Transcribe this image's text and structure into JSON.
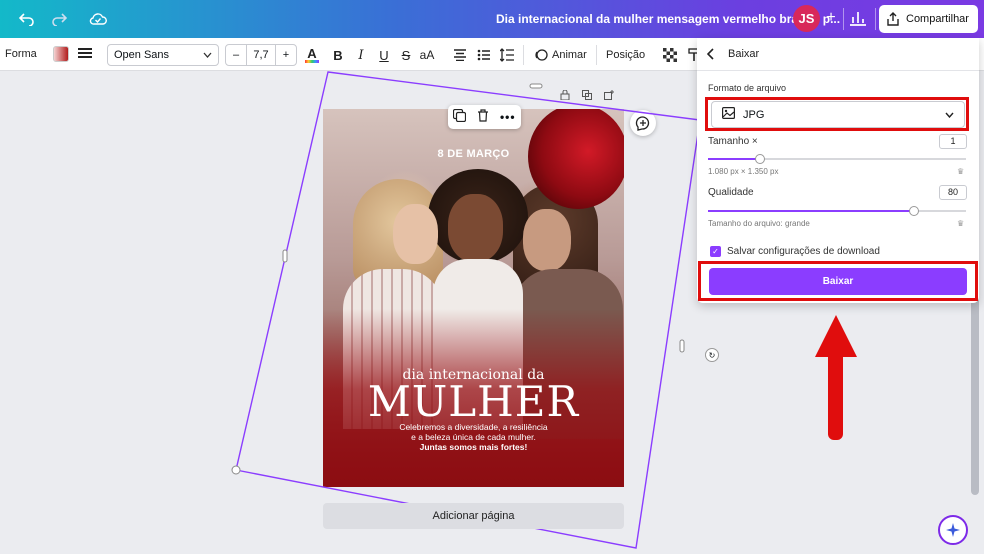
{
  "topbar": {
    "title": "Dia internacional da mulher mensagem vermelho branco p...",
    "avatar_initials": "JS",
    "plus": "+",
    "share_label": "Compartilhar",
    "gradient": [
      "#13b9c9",
      "#3a6fd6",
      "#6b3fe0",
      "#7a3ae3"
    ]
  },
  "toolbar": {
    "shape_label": "Forma",
    "font_name": "Open Sans",
    "font_size": "7,7",
    "minus": "–",
    "plus": "+",
    "bold": "B",
    "italic": "I",
    "underline": "U",
    "strike": "S",
    "case": "aA",
    "animate_label": "Animar",
    "position_label": "Posição",
    "text_color_glyph": "A"
  },
  "design": {
    "date_prefix": "8 DE",
    "date_month": "MARÇO",
    "line1": "dia internacional da",
    "line2": "MULHER",
    "body_line1": "Celebremos a diversidade, a resiliência",
    "body_line2": "e a beleza única de cada mulher.",
    "body_line3": "Juntas somos mais fortes!"
  },
  "canvas": {
    "add_page_label": "Adicionar página"
  },
  "download_panel": {
    "title": "Baixar",
    "file_format_label": "Formato de arquivo",
    "file_format_value": "JPG",
    "size_label": "Tamanho ×",
    "size_value": "1",
    "size_fill": 0.2,
    "dimensions": "1.080 px × 1.350 px",
    "quality_label": "Qualidade",
    "quality_value": "80",
    "quality_fill": 0.8,
    "file_size": "Tamanho do arquivo: grande",
    "save_settings_label": "Salvar configurações de download",
    "save_settings_checked": true,
    "download_button": "Baixar",
    "accent": "#8b3dff"
  },
  "annotations": {
    "highlight_color": "#e00d0d"
  }
}
